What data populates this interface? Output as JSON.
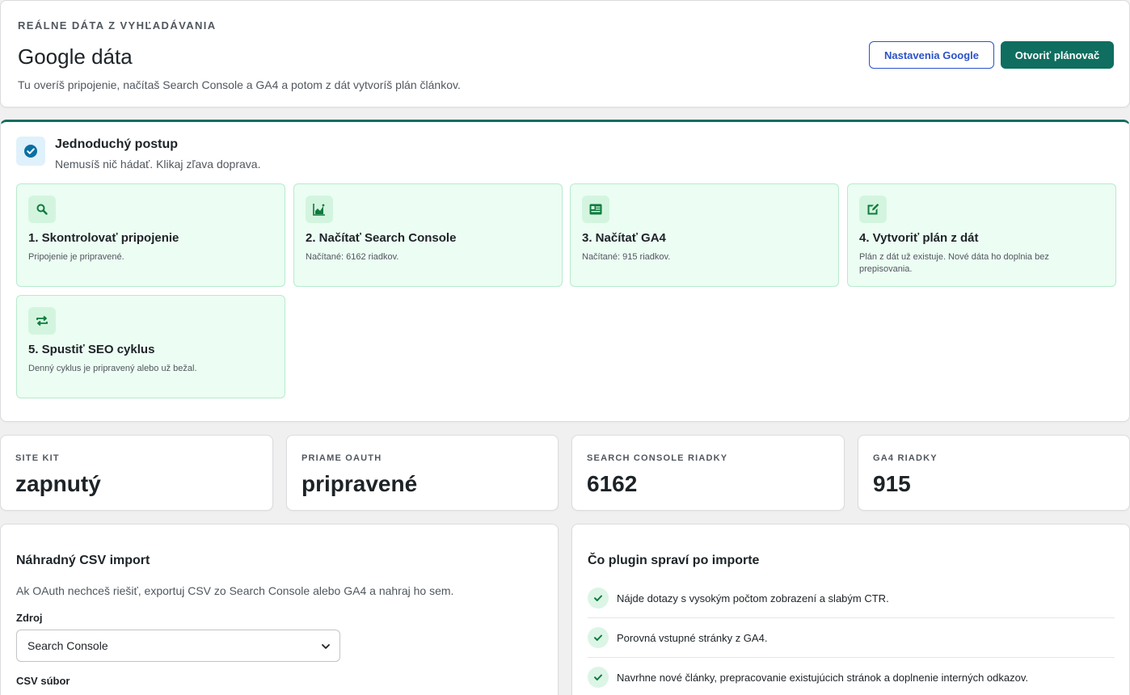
{
  "header": {
    "eyebrow": "REÁLNE DÁTA Z VYHĽADÁVANIA",
    "title": "Google dáta",
    "subtitle": "Tu overíš pripojenie, načítaš Search Console a GA4 a potom z dát vytvoríš plán článkov.",
    "btn_settings": "Nastavenia Google",
    "btn_planner": "Otvoriť plánovač"
  },
  "steps": {
    "title": "Jednoduchý postup",
    "subtitle": "Nemusíš nič hádať. Klikaj zľava doprava.",
    "items": [
      {
        "title": "1. Skontrolovať pripojenie",
        "desc": "Pripojenie je pripravené.",
        "icon": "search-icon"
      },
      {
        "title": "2. Načítať Search Console",
        "desc": "Načítané: 6162 riadkov.",
        "icon": "chart-icon"
      },
      {
        "title": "3. Načítať GA4",
        "desc": "Načítané: 915 riadkov.",
        "icon": "analytics-icon"
      },
      {
        "title": "4. Vytvoriť plán z dát",
        "desc": "Plán z dát už existuje. Nové dáta ho doplnia bez prepisovania.",
        "icon": "edit-icon"
      },
      {
        "title": "5. Spustiť SEO cyklus",
        "desc": "Denný cyklus je pripravený alebo už bežal.",
        "icon": "repeat-icon"
      }
    ]
  },
  "stats": [
    {
      "label": "SITE KIT",
      "value": "zapnutý"
    },
    {
      "label": "PRIAME OAUTH",
      "value": "pripravené"
    },
    {
      "label": "SEARCH CONSOLE RIADKY",
      "value": "6162"
    },
    {
      "label": "GA4 RIADKY",
      "value": "915"
    }
  ],
  "csv": {
    "title": "Náhradný CSV import",
    "subtitle": "Ak OAuth nechceš riešiť, exportuj CSV zo Search Console alebo GA4 a nahraj ho sem.",
    "source_label": "Zdroj",
    "source_value": "Search Console",
    "file_label": "CSV súbor"
  },
  "plugin": {
    "title": "Čo plugin spraví po importe",
    "items": [
      "Nájde dotazy s vysokým počtom zobrazení a slabým CTR.",
      "Porovná vstupné stránky z GA4.",
      "Navrhne nové články, prepracovanie existujúcich stránok a doplnenie interných odkazov."
    ]
  },
  "colors": {
    "primary": "#0f6e5f",
    "link": "#2c52c7",
    "step_bg": "#ecfdf3"
  }
}
